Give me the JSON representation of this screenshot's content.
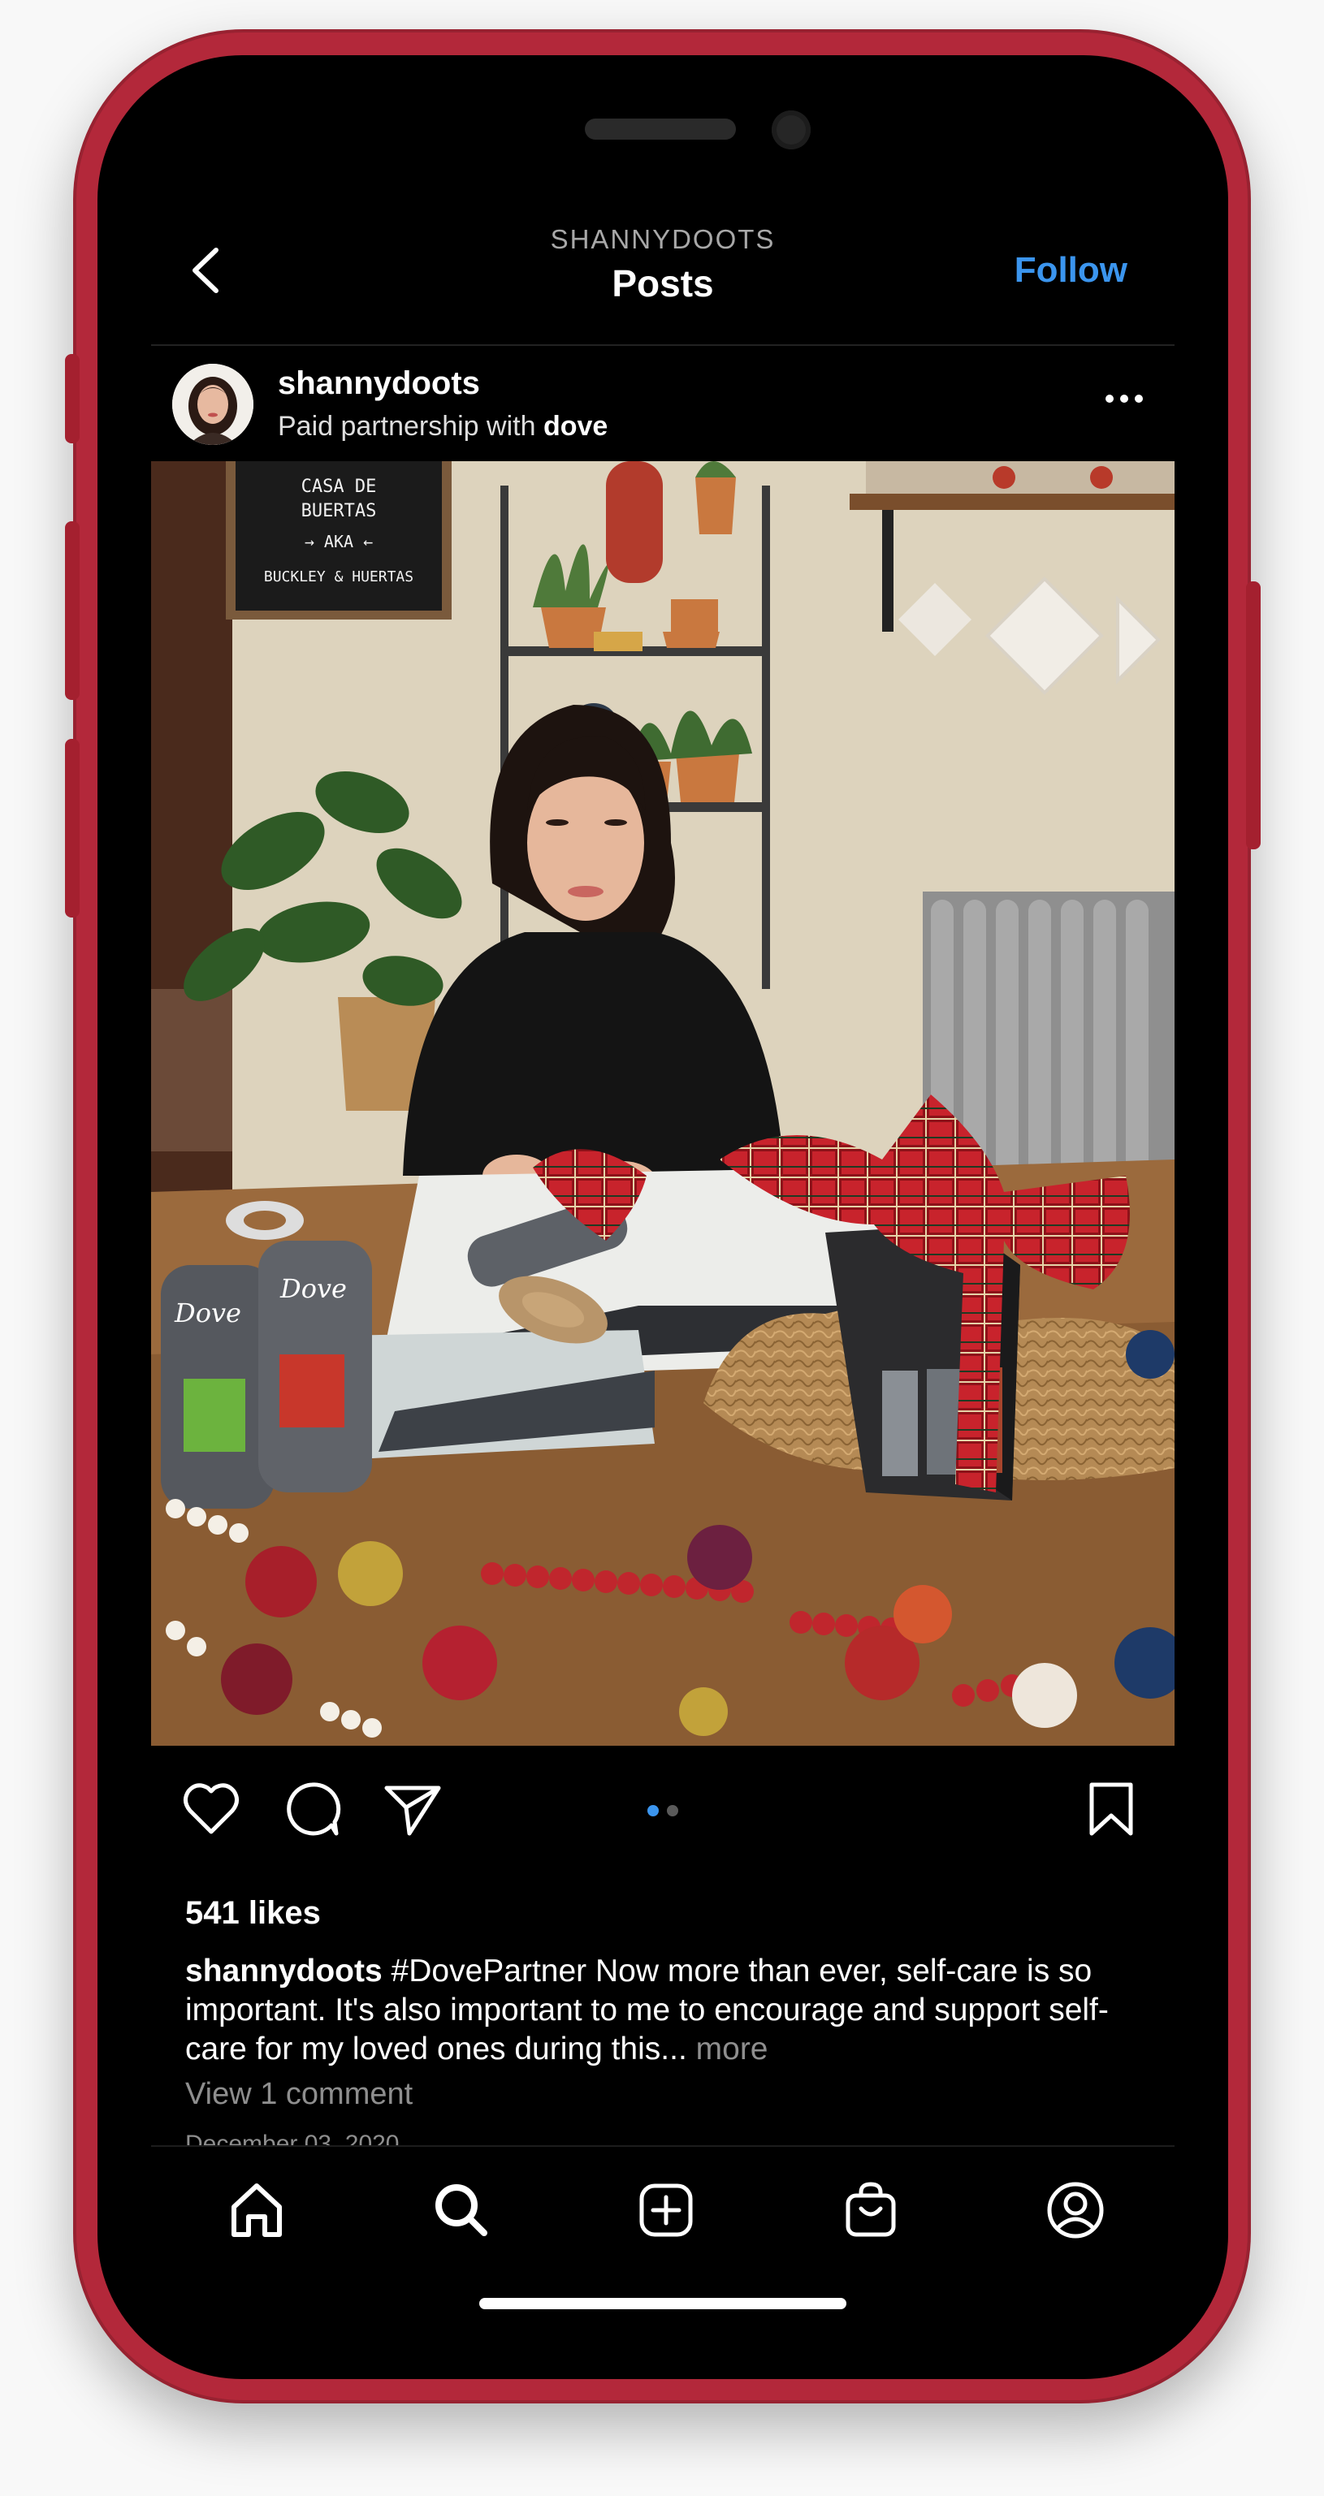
{
  "header": {
    "account": "SHANNYDOOTS",
    "title": "Posts",
    "follow_label": "Follow",
    "back_icon": "chevron-left-icon"
  },
  "post": {
    "username": "shannydoots",
    "partnership_prefix": "Paid partnership with ",
    "partner": "dove",
    "more_icon": "ellipsis-icon",
    "image_alt": "Woman wrapping Dove Men+Care gift set with plaid ribbon",
    "sign_text": [
      "CASA DE",
      "BUERTAS",
      "→ AKA ←",
      "BUCKLEY & HUERTAS"
    ],
    "carousel": {
      "total": 2,
      "current": 1
    },
    "likes": "541 likes",
    "caption_user": "shannydoots",
    "caption_text": " #DovePartner Now more than ever, self-care is so important. It's also important to me to encourage and support self-care for my loved ones during this... ",
    "caption_more": "more",
    "view_comments": "View 1 comment",
    "date_partial": "December 03, 2020"
  },
  "tabbar": {
    "items": [
      "home-icon",
      "search-icon",
      "create-icon",
      "shop-icon",
      "profile-icon"
    ]
  },
  "colors": {
    "frame": "#b3283a",
    "follow": "#3b95ee",
    "muted": "#8e8e8e",
    "carousel_active": "#3b95ee"
  }
}
